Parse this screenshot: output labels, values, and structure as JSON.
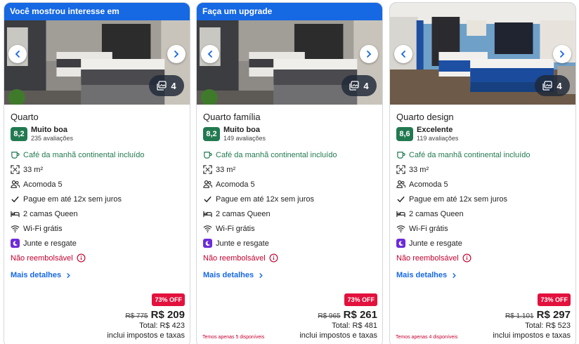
{
  "cards": [
    {
      "banner": "Você mostrou interesse em",
      "photo_count": "4",
      "room_name": "Quarto",
      "score": "8,2",
      "rating_label": "Muito boa",
      "rating_count": "235 avaliações",
      "amenities": {
        "breakfast": "Café da manhã continental incluído",
        "area": "33 m²",
        "sleeps": "Acomoda 5",
        "installments": "Pague em até 12x sem juros",
        "beds": "2 camas Queen",
        "wifi": "Wi-Fi grátis",
        "rewards": "Junte e resgate",
        "refund": "Não reembolsável"
      },
      "details_link": "Mais detalhes",
      "discount": "73% OFF",
      "old_price": "R$ 775",
      "new_price": "R$ 209",
      "total": "Total: R$ 423",
      "taxes": "inclui impostos e taxas",
      "availability": ""
    },
    {
      "banner": "Faça um upgrade",
      "photo_count": "4",
      "room_name": "Quarto família",
      "score": "8,2",
      "rating_label": "Muito boa",
      "rating_count": "149 avaliações",
      "amenities": {
        "breakfast": "Café da manhã continental incluído",
        "area": "33 m²",
        "sleeps": "Acomoda 5",
        "installments": "Pague em até 12x sem juros",
        "beds": "2 camas Queen",
        "wifi": "Wi-Fi grátis",
        "rewards": "Junte e resgate",
        "refund": "Não reembolsável"
      },
      "details_link": "Mais detalhes",
      "discount": "73% OFF",
      "old_price": "R$ 965",
      "new_price": "R$ 261",
      "total": "Total: R$ 481",
      "taxes": "inclui impostos e taxas",
      "availability": "Temos apenas 5 disponíveis"
    },
    {
      "banner": "",
      "photo_count": "4",
      "room_name": "Quarto design",
      "score": "8,6",
      "rating_label": "Excelente",
      "rating_count": "119 avaliações",
      "amenities": {
        "breakfast": "Café da manhã continental incluído",
        "area": "33 m²",
        "sleeps": "Acomoda 5",
        "installments": "Pague em até 12x sem juros",
        "beds": "2 camas Queen",
        "wifi": "Wi-Fi grátis",
        "rewards": "Junte e resgate",
        "refund": "Não reembolsável"
      },
      "details_link": "Mais detalhes",
      "discount": "73% OFF",
      "old_price": "R$ 1.101",
      "new_price": "R$ 297",
      "total": "Total: R$ 523",
      "taxes": "inclui impostos e taxas",
      "availability": "Temos apenas 4 disponíveis"
    }
  ],
  "colors": {
    "brand_blue": "#1668e3",
    "score_green": "#227950",
    "discount_red": "#e3113d",
    "refund_red": "#c3002f",
    "rewards_purple": "#6c2bd9"
  },
  "icons": {
    "breakfast": "coffee-cup-icon",
    "area": "expand-icon",
    "sleeps": "people-icon",
    "installments": "checkmark-icon",
    "beds": "bed-icon",
    "wifi": "wifi-icon",
    "rewards": "moon-icon",
    "refund": "info-icon",
    "gallery": "photos-icon"
  }
}
